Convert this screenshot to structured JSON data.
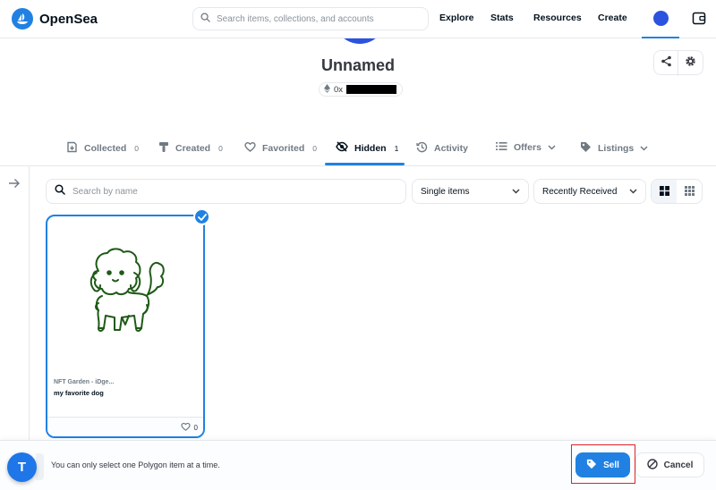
{
  "header": {
    "brand": "OpenSea",
    "search_placeholder": "Search items, collections, and accounts",
    "nav": [
      "Explore",
      "Stats",
      "Resources",
      "Create"
    ]
  },
  "profile": {
    "name": "Unnamed",
    "address_prefix": "0x"
  },
  "tabs": [
    {
      "label": "Collected",
      "count": "0",
      "icon": "collected-icon"
    },
    {
      "label": "Created",
      "count": "0",
      "icon": "paintbrush-icon"
    },
    {
      "label": "Favorited",
      "count": "0",
      "icon": "heart-icon"
    },
    {
      "label": "Hidden",
      "count": "1",
      "icon": "eye-slash-icon",
      "active": true
    },
    {
      "label": "Activity",
      "count": "",
      "icon": "history-icon"
    },
    {
      "label": "Offers",
      "count": "",
      "icon": "list-icon"
    },
    {
      "label": "Listings",
      "count": "",
      "icon": "tag-icon"
    }
  ],
  "filters": {
    "search_placeholder": "Search by name",
    "item_type": "Single items",
    "sort": "Recently Received"
  },
  "card": {
    "collection": "NFT Garden - iDge...",
    "title": "my favorite dog",
    "likes": "0"
  },
  "bottom_bar": {
    "message": "You can only select one Polygon item at a time.",
    "sell_label": "Sell",
    "cancel_label": "Cancel"
  },
  "floating": {
    "letter": "T"
  },
  "colors": {
    "accent": "#2081e2",
    "avatar": "#2c52e0",
    "highlight": "#e02424",
    "dog_stroke": "#1f5a17"
  }
}
